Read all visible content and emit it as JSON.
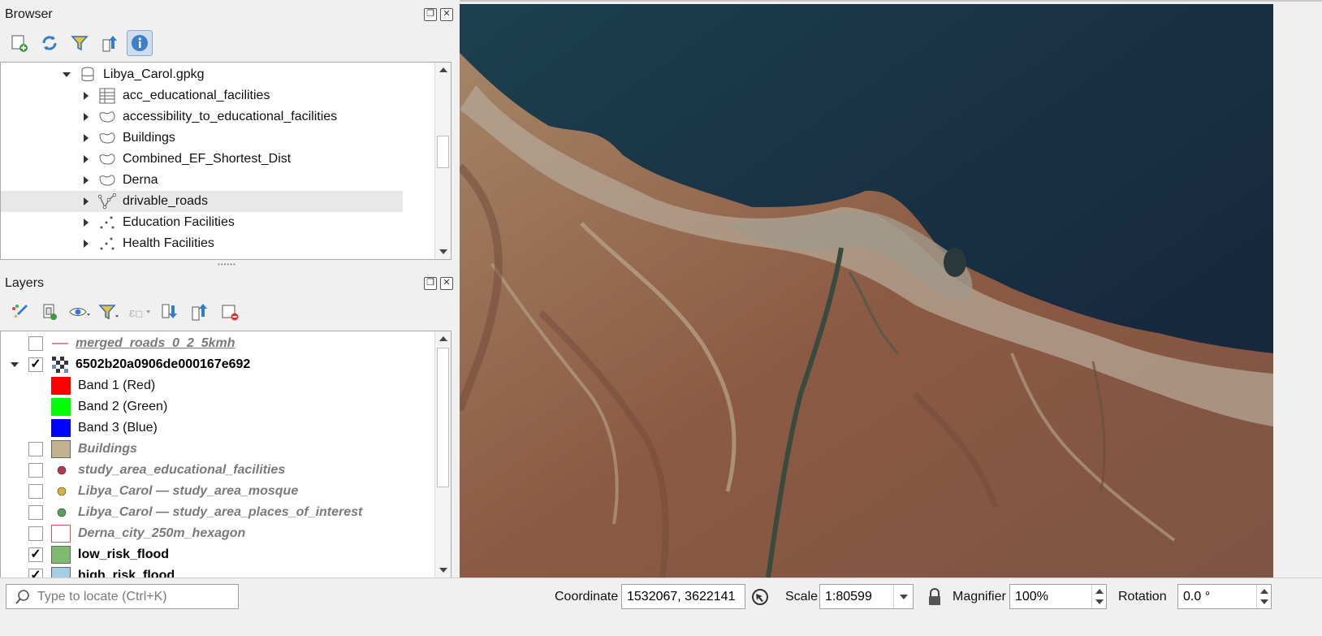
{
  "browser_panel": {
    "title": "Browser",
    "items": [
      {
        "label": "Libya_Carol.gpkg",
        "icon": "database-icon",
        "expanded": true
      },
      {
        "label": "acc_educational_facilities",
        "icon": "table-icon"
      },
      {
        "label": "accessibility_to_educational_facilities",
        "icon": "polygon-icon"
      },
      {
        "label": "Buildings",
        "icon": "polygon-icon"
      },
      {
        "label": "Combined_EF_Shortest_Dist",
        "icon": "polygon-icon"
      },
      {
        "label": "Derna",
        "icon": "polygon-icon"
      },
      {
        "label": "drivable_roads",
        "icon": "line-icon",
        "selected": true
      },
      {
        "label": "Education Facilities",
        "icon": "point-icon"
      },
      {
        "label": "Health Facilities",
        "icon": "point-icon"
      }
    ]
  },
  "layers_panel": {
    "title": "Layers",
    "items": [
      {
        "label": "merged_roads_0_2_5kmh",
        "checked": false
      },
      {
        "label": "6502b20a0906de000167e692",
        "checked": true
      },
      {
        "label": "Band 1 (Red)",
        "color": "#ff0000"
      },
      {
        "label": "Band 2 (Green)",
        "color": "#00ff00"
      },
      {
        "label": "Band 3 (Blue)",
        "color": "#0000ff"
      },
      {
        "label": "Buildings",
        "checked": false,
        "color": "#c2b28f"
      },
      {
        "label": "study_area_educational_facilities",
        "checked": false,
        "color": "#b5394b"
      },
      {
        "label": "Libya_Carol — study_area_mosque",
        "checked": false,
        "color": "#d8b43a"
      },
      {
        "label": "Libya_Carol — study_area_places_of_interest",
        "checked": false,
        "color": "#5aa05a"
      },
      {
        "label": "Derna_city_250m_hexagon",
        "checked": false,
        "color": "#e05050"
      },
      {
        "label": "low_risk_flood",
        "checked": true,
        "color": "#7fba6e"
      },
      {
        "label": "high_risk_flood",
        "checked": true,
        "color": "#a6cde3"
      }
    ]
  },
  "status_bar": {
    "locator_placeholder": "Type to locate (Ctrl+K)",
    "coordinate_label": "Coordinate",
    "coordinate_value": "1532067, 3622141",
    "scale_label": "Scale",
    "scale_value": "1:80599",
    "magnifier_label": "Magnifier",
    "magnifier_value": "100%",
    "rotation_label": "Rotation",
    "rotation_value": "0.0 °"
  }
}
